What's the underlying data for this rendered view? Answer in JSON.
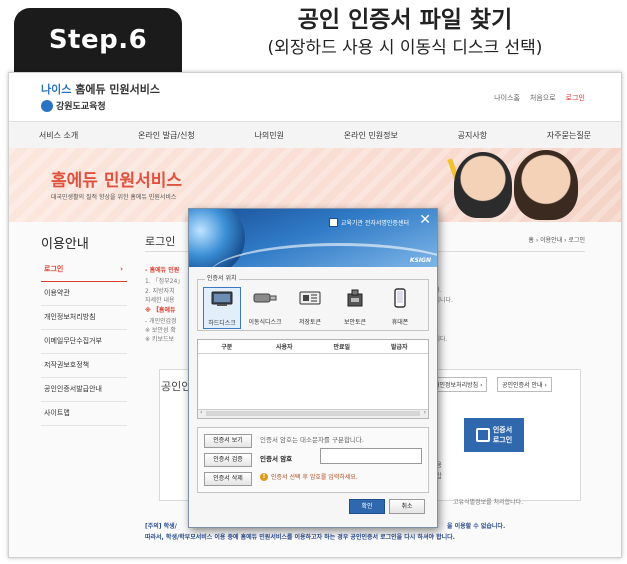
{
  "step": {
    "badge": "Step.6",
    "title": "공인 인증서 파일 찾기",
    "subtitle": "(외장하드 사용 시 이동식 디스크 선택)"
  },
  "site": {
    "logo_neis": "나이스",
    "logo_rest": " 홈에듀 민원서비스",
    "office": "강원도교육청",
    "toplinks": [
      "나이스홈",
      "처음으로",
      "로그인"
    ],
    "gnb": [
      "서비스 소개",
      "온라인 발급/신청",
      "나의민원",
      "온라인 민원정보",
      "공지사항",
      "자주묻는질문"
    ],
    "banner_title": "홈에듀 민원서비스",
    "banner_sub": "대국민생활의 질적 향상을 위한 홈에듀 민원서비스"
  },
  "sidebar": {
    "title": "이용안내",
    "items": [
      "로그인",
      "이용약관",
      "개인정보처리방침",
      "이메일무단수집거부",
      "저작권보호정책",
      "공인인증서발급안내",
      "사이트맵"
    ]
  },
  "content": {
    "title": "로그인",
    "breadcrumb": "홈 › 이용안내 › 로그인",
    "line_red": "- 홈에듀 민원",
    "lines": [
      "- 홈에듀 민원",
      "1. 「정부24」",
      "2. 지방자치",
      "자세한 내용",
      "※ 【홈에듀",
      "- 개인인감정",
      "※ 보안성 확",
      "※ 키보드보"
    ],
    "right_frags": [
      "니다.",
      "하십니다.",
      "습니다."
    ],
    "privacy_btn": "개인정보처리방침 ›",
    "cert_guide_btn": "공인인증서 안내 ›",
    "cert_section_title": "공인인",
    "cert_login_line1": "인증서",
    "cert_login_line2": "로그인",
    "side_note1": "사용",
    "side_note2": "바랍",
    "unique_id_text": "고유식별정보를 처리합니다.",
    "notice1": "[주의] 학생/",
    "notice1_end": "을 이용할 수 없습니다.",
    "notice2": "따라서, 학생/학부모서비스 이용 중에 홈에듀 민원서비스를 이용하고자 하는 경우 공인인증서 로그인을 다시 하셔야 합니다."
  },
  "modal": {
    "header_label": "교육기관 전자서명인증센터",
    "ksign": "KSIGN",
    "location_legend": "인증서 위치",
    "locations": [
      {
        "label": "하드디스크",
        "icon": "hard-disk-icon",
        "selected": true
      },
      {
        "label": "이동식디스크",
        "icon": "usb-drive-icon",
        "selected": false
      },
      {
        "label": "저장토큰",
        "icon": "security-token-icon",
        "selected": false
      },
      {
        "label": "보안토큰",
        "icon": "hsm-token-icon",
        "selected": false
      },
      {
        "label": "휴대폰",
        "icon": "mobile-phone-icon",
        "selected": false
      }
    ],
    "table_headers": [
      "구분",
      "사용자",
      "만료일",
      "발급자"
    ],
    "buttons": {
      "view": "인증서 보기",
      "verify": "인증서 검증",
      "delete": "인증서 삭제",
      "ok": "확인",
      "cancel": "취소"
    },
    "hint": "인증서 암호는 대소문자를 구분합니다.",
    "password_label": "인증서 암호",
    "warning": "인증서 선택 후 암호를 입력하세요."
  },
  "colors": {
    "accent_red": "#d9402f",
    "dialog_blue": "#2f68ad",
    "step_badge": "#1b1b1b"
  }
}
